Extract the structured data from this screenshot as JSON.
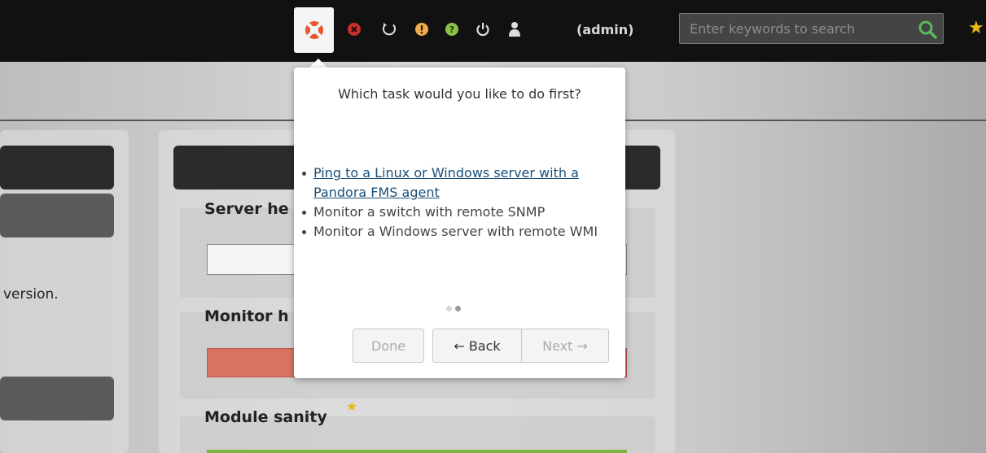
{
  "topbar": {
    "help_icon": "lifebuoy-icon",
    "icons": [
      {
        "name": "close-circle-icon",
        "color": "#c9302c"
      },
      {
        "name": "refresh-icon",
        "color": "#ffffff"
      },
      {
        "name": "warning-icon",
        "color": "#f0ad4e"
      },
      {
        "name": "question-icon",
        "color": "#8bc34a"
      },
      {
        "name": "power-icon",
        "color": "#ffffff"
      },
      {
        "name": "user-icon",
        "color": "#ffffff"
      }
    ],
    "user_label": "(admin)",
    "search": {
      "placeholder": "Enter keywords to search"
    },
    "accent": "#e8b90f"
  },
  "background": {
    "version_text": "version.",
    "headings": {
      "server_health": "Server he",
      "monitor_health": "Monitor h",
      "module_sanity": "Module sanity"
    }
  },
  "tour": {
    "title": "Which task would you like to do first?",
    "options": [
      {
        "label": "Ping to a Linux or Windows server with a Pandora FMS agent",
        "link": true
      },
      {
        "label": "Monitor a switch with remote SNMP",
        "link": false
      },
      {
        "label": "Monitor a Windows server with remote WMI",
        "link": false
      }
    ],
    "steps": {
      "total": 2,
      "current": 2
    },
    "buttons": {
      "done": "Done",
      "back": "← Back",
      "next": "Next →"
    },
    "link_color": "#1a4f7a"
  }
}
